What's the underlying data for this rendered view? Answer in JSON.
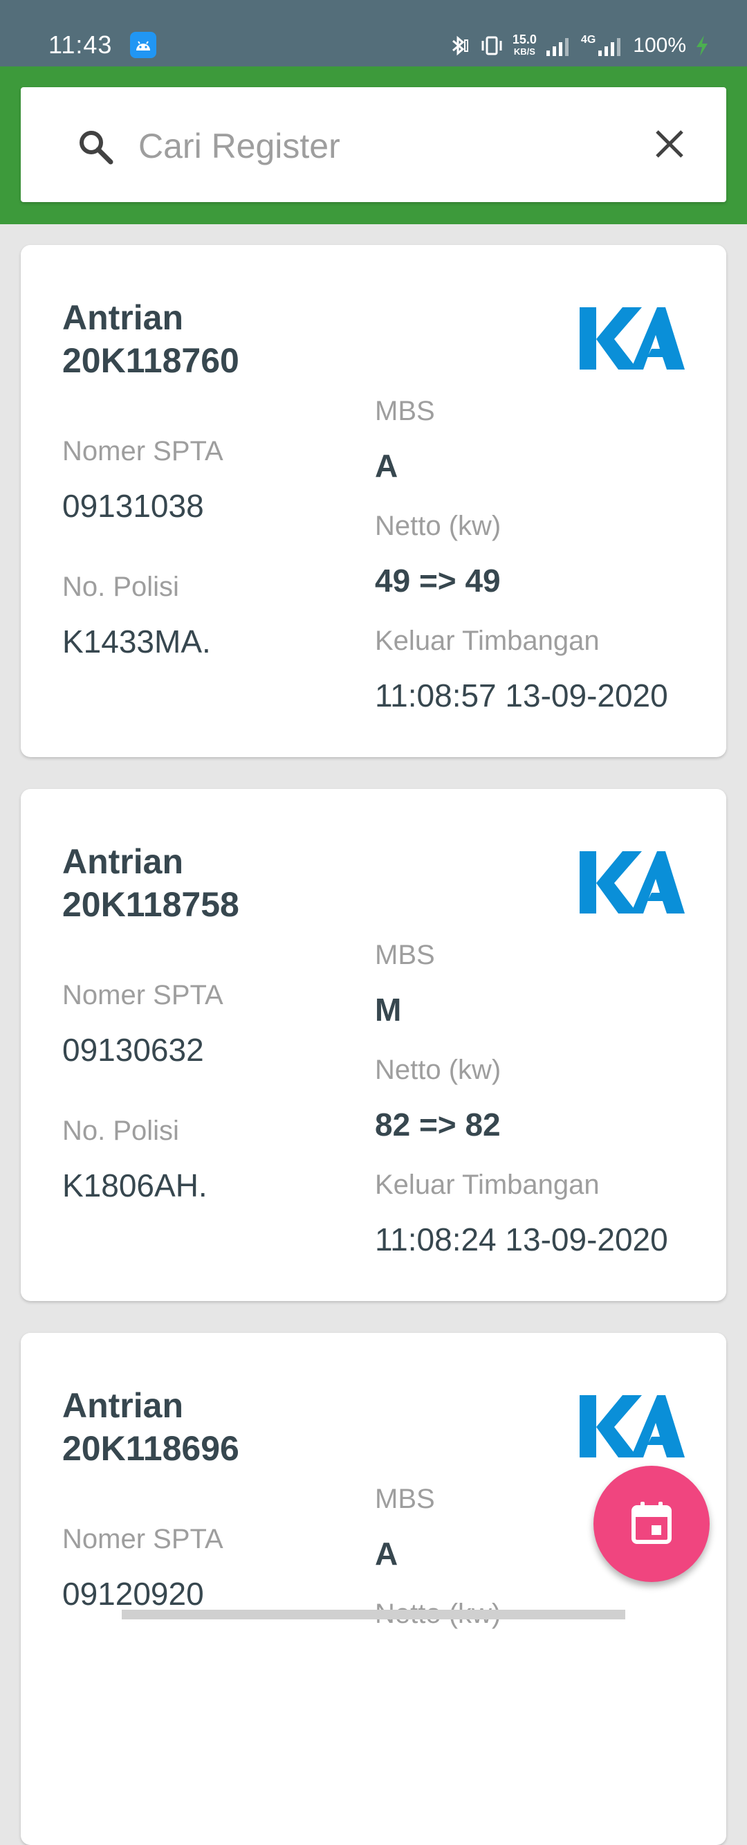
{
  "status_bar": {
    "time": "11:43",
    "speed_value": "15.0",
    "speed_unit": "KB/S",
    "network": "4G",
    "battery": "100%"
  },
  "search": {
    "placeholder": "Cari Register",
    "value": ""
  },
  "labels": {
    "nomer_spta": "Nomer SPTA",
    "no_polisi": "No. Polisi",
    "mbs": "MBS",
    "netto": "Netto (kw)",
    "keluar_timbangan": "Keluar Timbangan"
  },
  "cards": [
    {
      "title_line1": "Antrian",
      "title_line2": "20K118760",
      "nomer_spta": "09131038",
      "no_polisi": "K1433MA.",
      "mbs": "A",
      "netto": "49 => 49",
      "keluar_timbangan": "11:08:57 13-09-2020"
    },
    {
      "title_line1": "Antrian",
      "title_line2": "20K118758",
      "nomer_spta": "09130632",
      "no_polisi": "K1806AH.",
      "mbs": "M",
      "netto": "82 => 82",
      "keluar_timbangan": "11:08:24 13-09-2020"
    },
    {
      "title_line1": "Antrian",
      "title_line2": "20K118696",
      "nomer_spta": "09120920",
      "mbs": "A"
    }
  ],
  "colors": {
    "header_green": "#3d9a3b",
    "status_bar": "#546e7a",
    "logo_blue": "#0a8fd8",
    "fab_pink": "#f0457f"
  },
  "icons": {
    "search": "search-icon",
    "clear": "close-icon",
    "fab": "calendar-icon",
    "logo": "ka-logo"
  }
}
